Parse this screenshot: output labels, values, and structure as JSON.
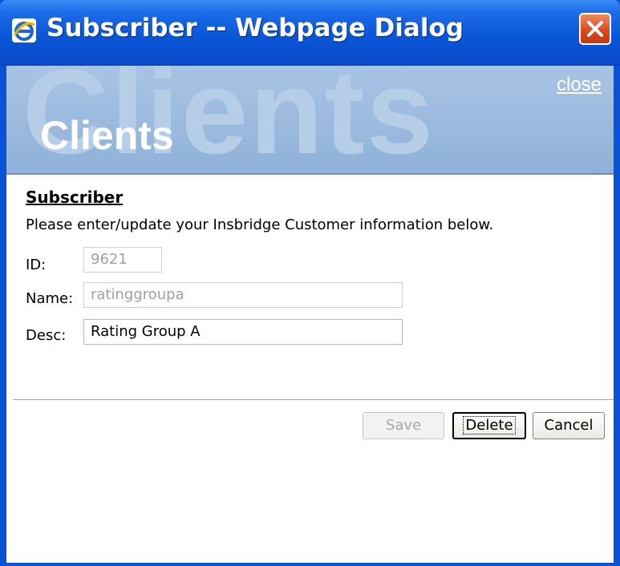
{
  "window": {
    "title": "Subscriber -- Webpage Dialog",
    "icon": "internet-explorer-icon",
    "close_icon": "close-icon"
  },
  "banner": {
    "watermark": "Clients",
    "title": "Clients",
    "close_link": "close"
  },
  "form": {
    "heading": "Subscriber",
    "instructions": "Please enter/update your Insbridge Customer information below.",
    "fields": {
      "id": {
        "label": "ID:",
        "value": "9621",
        "disabled": true
      },
      "name": {
        "label": "Name:",
        "value": "ratinggroupa",
        "disabled": true
      },
      "desc": {
        "label": "Desc:",
        "value": "Rating Group A",
        "disabled": false
      }
    }
  },
  "buttons": {
    "save": "Save",
    "delete": "Delete",
    "cancel": "Cancel"
  },
  "colors": {
    "titlebar": "#0a56d8",
    "banner": "#9bbbe0",
    "close_button": "#d8461e"
  }
}
